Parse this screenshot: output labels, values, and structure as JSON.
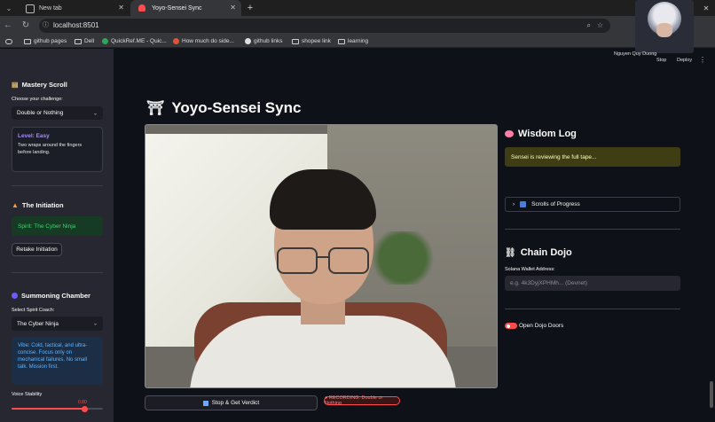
{
  "browser": {
    "tabs": [
      {
        "label": "New tab"
      },
      {
        "label": "Yoyo-Sensei Sync"
      }
    ],
    "url": "localhost:8501",
    "bookmarks": [
      "github pages",
      "Dell",
      "QuickRef.ME - Quic...",
      "How much do side...",
      "github links",
      "shopee link",
      "learning"
    ]
  },
  "overlay": {
    "name": "Nguyen Quy Duong",
    "menu_items": [
      "Stop",
      "Deploy"
    ]
  },
  "sidebar": {
    "mastery": {
      "heading": "Mastery Scroll",
      "label": "Choose your challenge:",
      "selected": "Double or Nothing",
      "level_title": "Level: Easy",
      "level_desc": "Two wraps around the fingers before landing."
    },
    "initiation": {
      "heading": "The Initiation",
      "spirit": "Spirit: The Cyber Ninja",
      "retake": "Retake Initiation"
    },
    "summoning": {
      "heading": "Summoning Chamber",
      "label": "Select Spirit Coach:",
      "selected": "The Cyber Ninja",
      "vibe": "Vibe: Cold, tactical, and ultra-concise. Focus only on mechanical failures. No small talk. Mission first.",
      "stability_label": "Voice Stability",
      "stability_value": "0.80",
      "stability_fraction": 0.8
    }
  },
  "main": {
    "title": "Yoyo-Sensei Sync",
    "stop_button": "Stop & Get Verdict",
    "recording": "● RECORDING: Double or Nothing",
    "wisdom": {
      "heading": "Wisdom Log",
      "status": "Sensei is reviewing the full tape...",
      "expander": "Scrolls of Progress"
    },
    "dojo": {
      "heading": "Chain Dojo",
      "wallet_label": "Solana Wallet Address:",
      "wallet_placeholder": "e.g. 4k3DyjXPHMh... (Devnet)",
      "toggle_label": "Open Dojo Doors"
    }
  },
  "colors": {
    "accent": "#ff4b4b",
    "success": "#3dd56d",
    "info": "#60b4ff"
  }
}
